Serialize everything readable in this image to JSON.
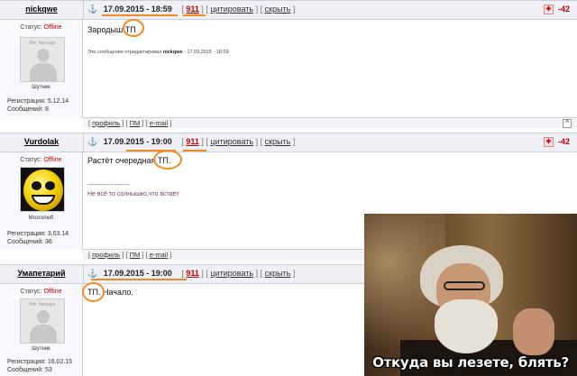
{
  "labels": {
    "status": "Статус:",
    "registration": "Регистрация:",
    "messages": "Сообщений:",
    "citation": "цитировать",
    "hide": "скрыть",
    "profile": "профиль",
    "pm": "ПМ",
    "email": "e-mail",
    "up_arrow": "^"
  },
  "posts": [
    {
      "username": "nickqwe",
      "status": "Offline",
      "avatar_text": "Нет Аватара",
      "rank": "Шутник",
      "registration": "5.12.14",
      "messages": "8",
      "date": "17.09.2015 - 18:59",
      "post_number": "911",
      "rating": "-42",
      "text": "Зародыш ТП",
      "edited_prefix": "Это сообщение отредактировал",
      "edited_by": "nickqwe",
      "edited_date": "- 17.09.2015 - 18:59"
    },
    {
      "username": "Vurdolak",
      "status": "Offline",
      "rank": "Мозголюб",
      "registration": "3.03.14",
      "messages": "36",
      "date": "17.09.2015 - 19:00",
      "post_number": "911",
      "rating": "-42",
      "text": "Растёт очередная ТП.",
      "signature_line": "--------------------",
      "signature": "Не всё то солнышко,что встаёт"
    },
    {
      "username": "Умапетарий",
      "status": "Offline",
      "avatar_text": "Нет Аватара",
      "rank": "Шутник",
      "registration": "16.02.15",
      "messages": "53",
      "date": "17.09.2015 - 19:00",
      "post_number": "911",
      "text": "ТП. Начало."
    }
  ],
  "meme": {
    "caption": "Откуда вы лезете, блять?"
  },
  "colors": {
    "annotation": "#f08a23",
    "header_bg": "#eef0f6",
    "offline": "#cc0000"
  }
}
